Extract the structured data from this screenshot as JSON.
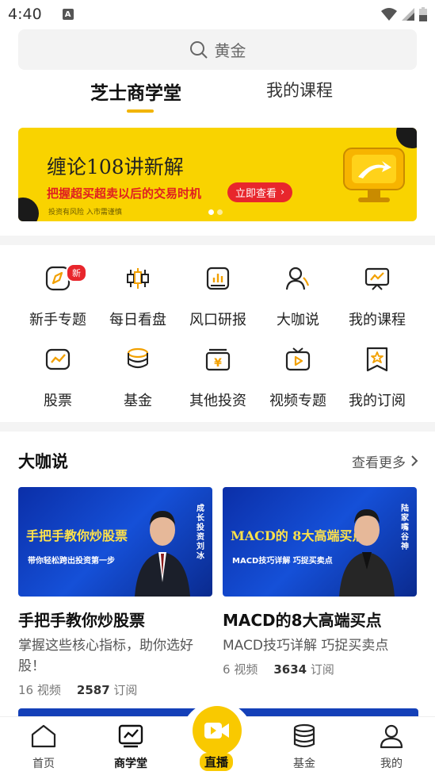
{
  "status": {
    "time": "4:40"
  },
  "search": {
    "text": "黄金"
  },
  "tabs": [
    {
      "label": "芝士商学堂"
    },
    {
      "label": "我的课程"
    }
  ],
  "banner": {
    "title": "缠论108讲新解",
    "subtitle": "把握超买超卖以后的交易时机",
    "cta": "立即查看",
    "note": "投资有风险 入市需谨慎"
  },
  "categories": [
    {
      "label": "新手专题",
      "icon": "compass-icon",
      "badge": "新"
    },
    {
      "label": "每日看盘",
      "icon": "candlestick-icon"
    },
    {
      "label": "风口研报",
      "icon": "report-chart-icon"
    },
    {
      "label": "大咖说",
      "icon": "speaker-person-icon"
    },
    {
      "label": "我的课程",
      "icon": "presentation-board-icon"
    },
    {
      "label": "股票",
      "icon": "stock-chart-icon"
    },
    {
      "label": "基金",
      "icon": "coin-stack-icon"
    },
    {
      "label": "其他投资",
      "icon": "yen-box-icon"
    },
    {
      "label": "视频专题",
      "icon": "tv-play-icon"
    },
    {
      "label": "我的订阅",
      "icon": "bookmark-star-icon"
    }
  ],
  "section": {
    "title": "大咖说",
    "more": "查看更多"
  },
  "cards": [
    {
      "thumb_title": "手把手教你炒股票",
      "thumb_sub": "带你轻松跨出投资第一步",
      "thumb_vertical": "成长投资刘冰",
      "title": "手把手教你炒股票",
      "desc": "掌握这些核心指标，助你选好股！",
      "videos": "16",
      "videos_label": "视频",
      "subs": "2587",
      "subs_label": "订阅"
    },
    {
      "thumb_title": "MACD的 8大高端买点",
      "thumb_sub": "MACD技巧详解 巧捉买卖点",
      "thumb_vertical": "陆家嘴谷神",
      "title": "MACD的8大高端买点",
      "desc": "MACD技巧详解 巧捉买卖点",
      "videos": "6",
      "videos_label": "视频",
      "subs": "3634",
      "subs_label": "订阅"
    }
  ],
  "nav": [
    {
      "label": "首页",
      "icon": "home-icon"
    },
    {
      "label": "商学堂",
      "icon": "chart-board-icon"
    },
    {
      "label": "直播",
      "icon": "video-camera-icon"
    },
    {
      "label": "基金",
      "icon": "database-icon"
    },
    {
      "label": "我的",
      "icon": "user-icon"
    }
  ],
  "colors": {
    "accent": "#f9c900",
    "banner": "#f9d300",
    "red": "#e8262c",
    "thumb_blue": "#1550d8"
  }
}
